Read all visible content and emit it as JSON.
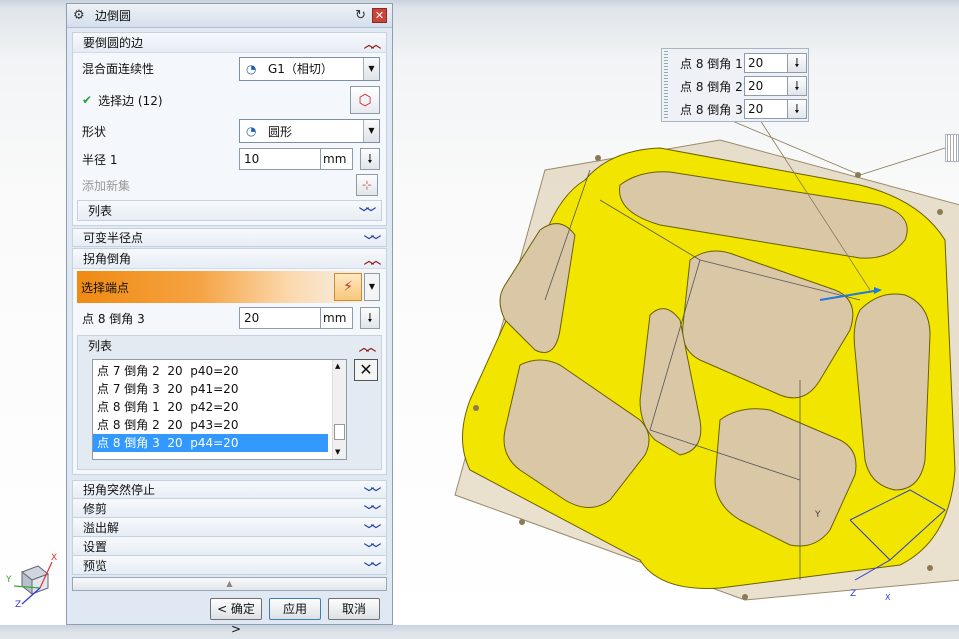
{
  "dialog": {
    "title": "边倒圆",
    "sections": {
      "edges": {
        "header": "要倒圆的边",
        "blend_label": "混合面连续性",
        "blend_value": "G1（相切）",
        "select_label": "选择边 (12)",
        "shape_label": "形状",
        "shape_value": "圆形",
        "radius_label": "半径 1",
        "radius_value": "10",
        "radius_unit": "mm",
        "add_set_label": "添加新集",
        "list_label": "列表"
      },
      "variable_radius": {
        "header": "可变半径点"
      },
      "corner_setback": {
        "header": "拐角倒角",
        "select_endpoint_label": "选择端点",
        "point_label": "点 8 倒角 3",
        "point_value": "20",
        "point_unit": "mm",
        "list_label": "列表",
        "list_items": [
          "点 7 倒角 2  20  p40=20",
          "点 7 倒角 3  20  p41=20",
          "点 8 倒角 1  20  p42=20",
          "点 8 倒角 2  20  p43=20",
          "点 8 倒角 3  20  p44=20"
        ],
        "selected_index": 4
      },
      "corner_stop": {
        "header": "拐角突然停止"
      },
      "trim": {
        "header": "修剪"
      },
      "overflow": {
        "header": "溢出解"
      },
      "settings": {
        "header": "设置"
      },
      "preview": {
        "header": "预览"
      }
    },
    "buttons": {
      "ok": "< 确定 >",
      "apply": "应用",
      "cancel": "取消"
    }
  },
  "popup": {
    "rows": [
      {
        "label": "点 8 倒角 1",
        "value": "20"
      },
      {
        "label": "点 8 倒角 2",
        "value": "20"
      },
      {
        "label": "点 8 倒角 3",
        "value": "20"
      }
    ]
  },
  "triad": {
    "x": "X",
    "y": "Y",
    "z": "Z"
  },
  "colors": {
    "fillet": "#f2e600",
    "box": "#d9c7a6",
    "accent": "#f08a12",
    "selection": "#3399ff"
  },
  "icons": {
    "gear": "gear-icon",
    "reset": "reset-icon",
    "close": "close-icon",
    "cube": "cube-icon",
    "delete": "delete-icon",
    "pin": "point-select-icon"
  }
}
